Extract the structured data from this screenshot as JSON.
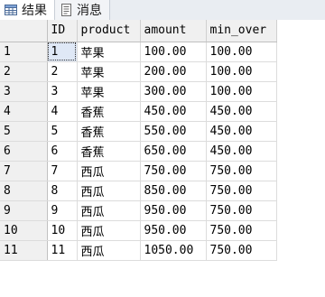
{
  "tabs": [
    {
      "label": "结果",
      "icon": "grid-results-icon",
      "active": true
    },
    {
      "label": "消息",
      "icon": "messages-icon",
      "active": false
    }
  ],
  "grid": {
    "columns": [
      "ID",
      "product",
      "amount",
      "min_over"
    ],
    "rows": [
      {
        "rownum": "1",
        "cells": [
          "1",
          "苹果",
          "100.00",
          "100.00"
        ]
      },
      {
        "rownum": "2",
        "cells": [
          "2",
          "苹果",
          "200.00",
          "100.00"
        ]
      },
      {
        "rownum": "3",
        "cells": [
          "3",
          "苹果",
          "300.00",
          "100.00"
        ]
      },
      {
        "rownum": "4",
        "cells": [
          "4",
          "香蕉",
          "450.00",
          "450.00"
        ]
      },
      {
        "rownum": "5",
        "cells": [
          "5",
          "香蕉",
          "550.00",
          "450.00"
        ]
      },
      {
        "rownum": "6",
        "cells": [
          "6",
          "香蕉",
          "650.00",
          "450.00"
        ]
      },
      {
        "rownum": "7",
        "cells": [
          "7",
          "西瓜",
          "750.00",
          "750.00"
        ]
      },
      {
        "rownum": "8",
        "cells": [
          "8",
          "西瓜",
          "850.00",
          "750.00"
        ]
      },
      {
        "rownum": "9",
        "cells": [
          "9",
          "西瓜",
          "950.00",
          "750.00"
        ]
      },
      {
        "rownum": "10",
        "cells": [
          "10",
          "西瓜",
          "950.00",
          "750.00"
        ]
      },
      {
        "rownum": "11",
        "cells": [
          "11",
          "西瓜",
          "1050.00",
          "750.00"
        ]
      }
    ]
  },
  "colors": {
    "tabbar_bg": "#e9edf2",
    "header_bg": "#f0f0f0",
    "gridline": "#dcdcdc",
    "selection_bg": "#dfe8f6"
  }
}
